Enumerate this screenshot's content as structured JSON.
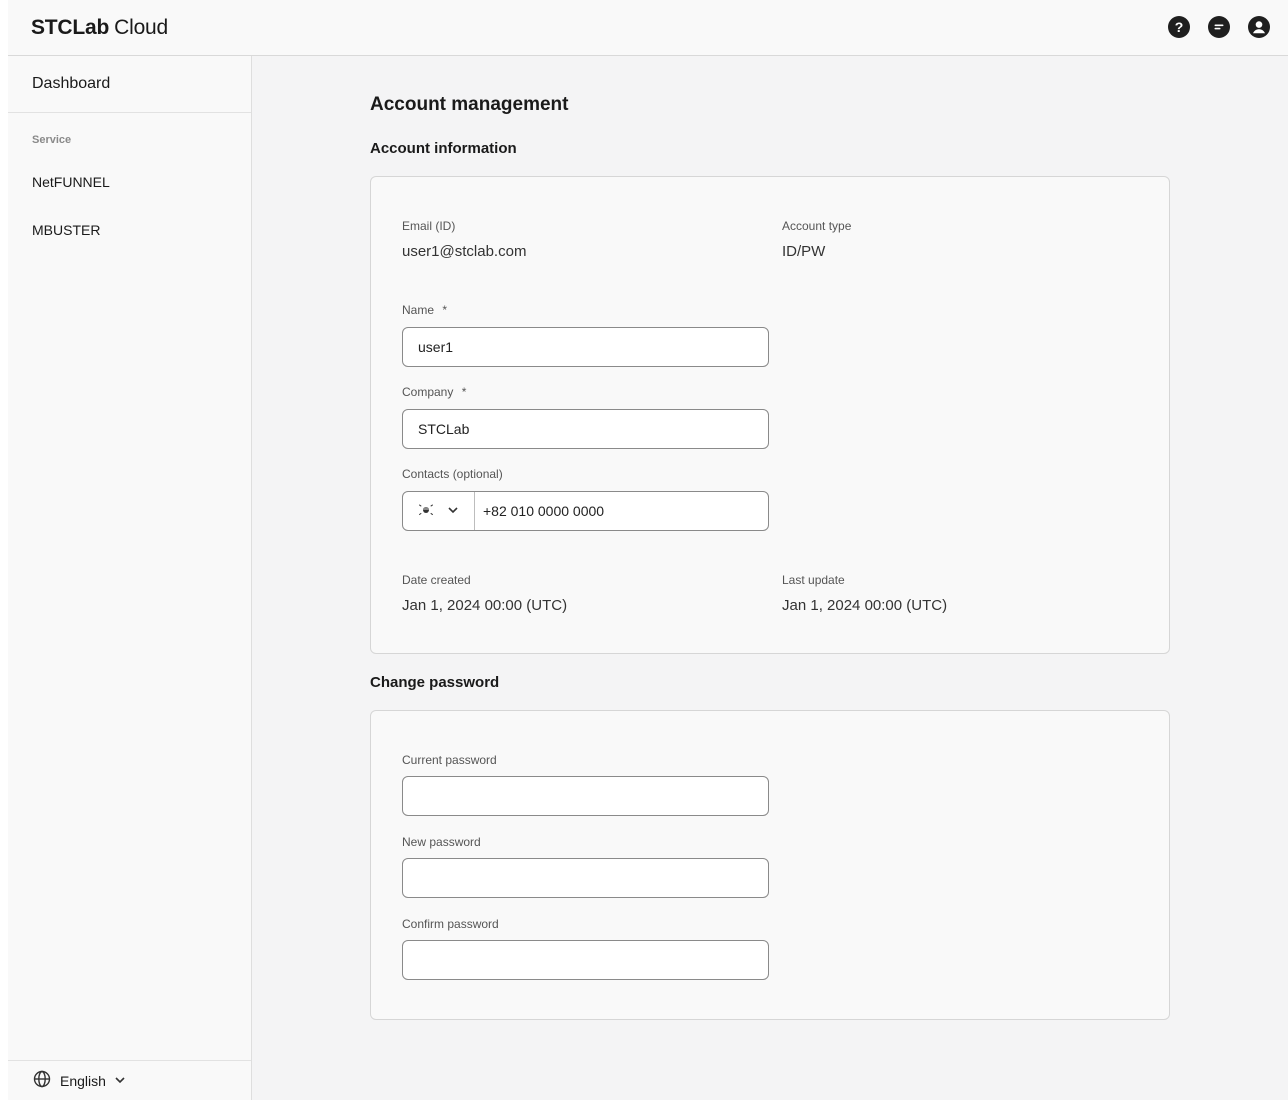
{
  "app": {
    "logo_strong": "STCLab",
    "logo_light": "Cloud"
  },
  "header_icons": [
    "help-icon",
    "chat-icon",
    "account-icon"
  ],
  "sidebar": {
    "dashboard": "Dashboard",
    "section": "Service",
    "items": [
      {
        "label": "NetFUNNEL"
      },
      {
        "label": "MBUSTER"
      }
    ],
    "language": "English"
  },
  "page": {
    "title": "Account management"
  },
  "account_info": {
    "title": "Account information",
    "email_label": "Email (ID)",
    "email_value": "user1@stclab.com",
    "type_label": "Account type",
    "type_value": "ID/PW",
    "name_label": "Name",
    "name_value": "user1",
    "company_label": "Company",
    "company_value": "STCLab",
    "required_mark": "*",
    "contacts_label": "Contacts (optional)",
    "phone_value": "+82 010 0000 0000",
    "created_label": "Date created",
    "created_value": "Jan 1, 2024 00:00 (UTC)",
    "updated_label": "Last update",
    "updated_value": "Jan 1, 2024 00:00 (UTC)"
  },
  "change_password": {
    "title": "Change password",
    "current_label": "Current password",
    "new_label": "New password",
    "confirm_label": "Confirm password"
  },
  "colors": {
    "text": "#1a1a1a",
    "border": "#d6d6d6",
    "background": "#f4f4f5"
  }
}
